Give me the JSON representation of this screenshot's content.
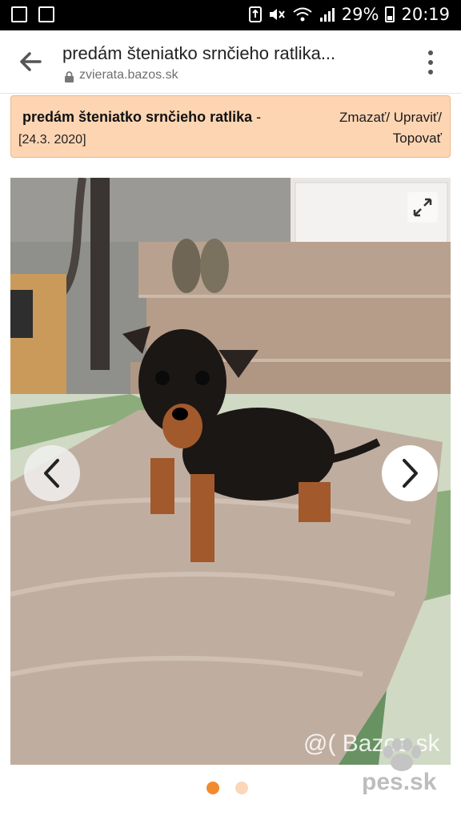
{
  "status_bar": {
    "battery": "29%",
    "time": "20:19"
  },
  "browser": {
    "page_title": "predám šteniatko srnčieho ratlika...",
    "url": "zvierata.bazos.sk"
  },
  "listing": {
    "title": "predám šteniatko srnčieho ratlika",
    "title_suffix": " -",
    "date": "[24.3. 2020]",
    "action_line1": "Zmazať/ Upraviť/",
    "action_line2": "Topovať"
  },
  "photo": {
    "watermark": "@( Bazos.sk"
  },
  "carousel": {
    "total": 2,
    "active_index": 0
  },
  "logo": {
    "text": "pes.sk"
  },
  "colors": {
    "listing_bg": "#fdd5b3",
    "listing_border": "#f0b58a",
    "dot_active": "#f28a2e",
    "dot_inactive": "#fbd7b8"
  },
  "icons": [
    "image-icon",
    "screenshot-icon",
    "storage-icon",
    "mute-icon",
    "wifi-icon",
    "signal-icon",
    "battery-icon",
    "back-arrow-icon",
    "lock-icon",
    "more-vert-icon",
    "expand-icon",
    "chevron-left-icon",
    "chevron-right-icon",
    "paw-icon"
  ]
}
